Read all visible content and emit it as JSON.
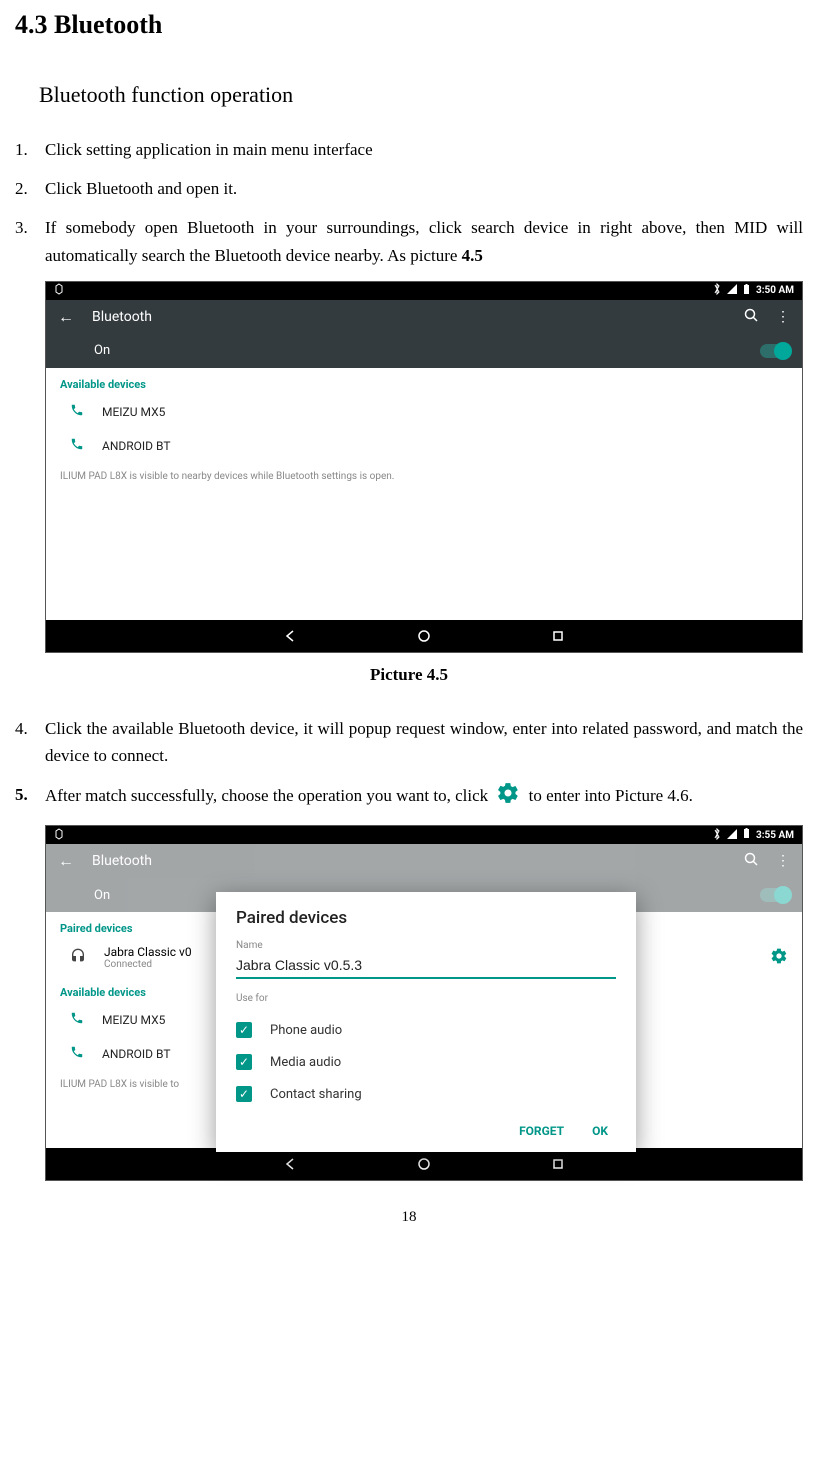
{
  "section_heading": "4.3    Bluetooth",
  "subheading": "Bluetooth function operation",
  "steps": {
    "n1": "1.",
    "t1": "Click setting application in main menu interface",
    "n2": "2.",
    "t2": "Click Bluetooth and open it.",
    "n3": "3.",
    "t3_a": "If somebody open Bluetooth in your surroundings, click search device in right above, then MID will automatically search the Bluetooth device nearby. As picture ",
    "t3_b": "4.5",
    "n4": "4.",
    "t4": "Click the available Bluetooth device, it will popup request window, enter into related password, and match the device to connect.",
    "n5": "5.",
    "t5_a": "After match successfully, choose the operation you want to, click",
    "t5_b": "to enter into Picture 4.6."
  },
  "picture_caption": "Picture 4.5",
  "page_num": "18",
  "s1": {
    "time": "3:50 AM",
    "title": "Bluetooth",
    "toggle_label": "On",
    "available_label": "Available devices",
    "dev1": "MEIZU MX5",
    "dev2": "ANDROID BT",
    "note": "ILIUM PAD L8X is visible to nearby devices while Bluetooth settings is open."
  },
  "s2": {
    "time": "3:55 AM",
    "title": "Bluetooth",
    "toggle_label": "On",
    "paired_label": "Paired devices",
    "paired_name": "Jabra Classic v0",
    "paired_status": "Connected",
    "available_label": "Available devices",
    "dev1": "MEIZU MX5",
    "dev2": "ANDROID BT",
    "note": "ILIUM PAD L8X is visible to",
    "modal": {
      "title": "Paired devices",
      "name_label": "Name",
      "name_value": "Jabra Classic v0.5.3",
      "use_for": "Use for",
      "opt1": "Phone audio",
      "opt2": "Media audio",
      "opt3": "Contact sharing",
      "forget": "FORGET",
      "ok": "OK"
    }
  }
}
